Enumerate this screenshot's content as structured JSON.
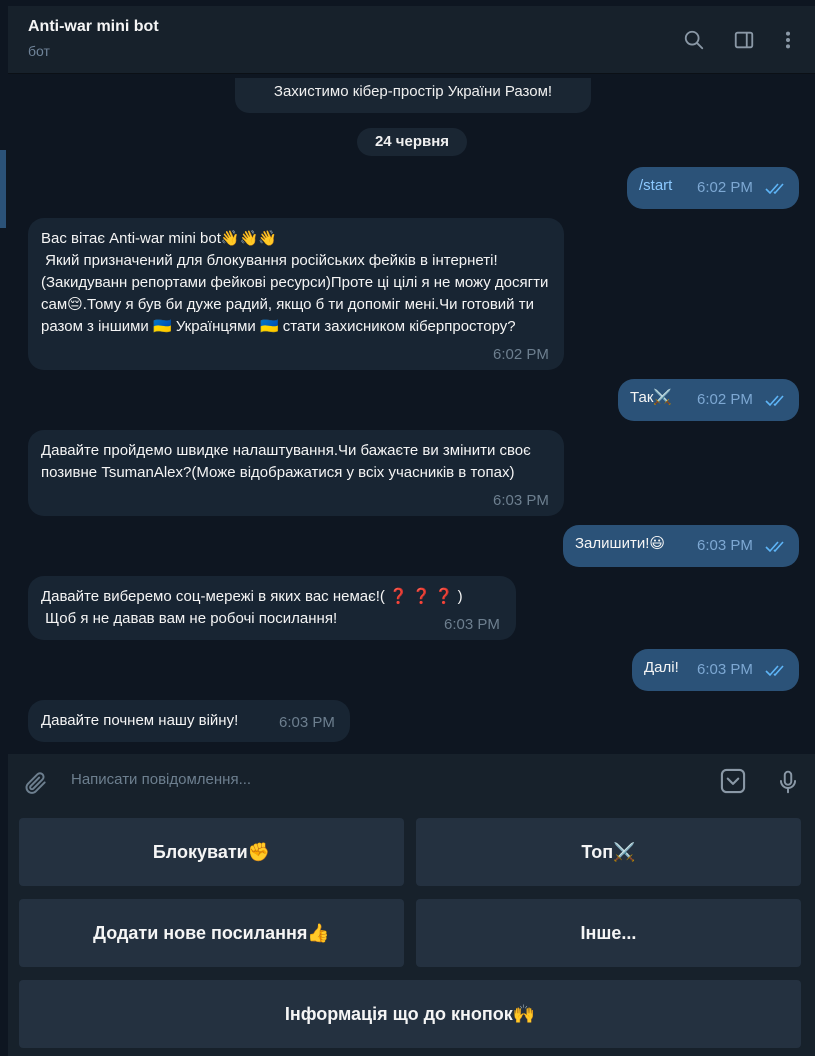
{
  "header": {
    "title": "Anti-war mini bot",
    "subtitle": "бот",
    "icons": [
      "search-icon",
      "sidebar-toggle-icon",
      "more-vertical-icon"
    ]
  },
  "chat": {
    "service_message": "Захистимо кібер-простір України Разом!",
    "date_badge": "24 червня",
    "messages": [
      {
        "direction": "out",
        "text": "/start",
        "time": "6:02 PM",
        "status": "read"
      },
      {
        "direction": "in",
        "text": "Вас вітає Anti-war mini bot👋👋👋\n Який призначений для блокування російських фейків в інтернеті!(Закидуванн репортами фейкові ресурси)Проте ці цілі я не можу досягти сам😔.Тому я був би дуже радий, якщо б ти допоміг мені.Чи готовий ти разом з іншими 🇺🇦 Українцями 🇺🇦 стати захисником кіберпростору?",
        "time": "6:02 PM"
      },
      {
        "direction": "out",
        "text": "Так⚔️",
        "time": "6:02 PM",
        "status": "read"
      },
      {
        "direction": "in",
        "text": "Давайте пройдемо швидке налаштування.Чи бажаєте ви змінити своє позивне TsumanAlex?(Може відображатися у всіх учасників в топах)",
        "time": "6:03 PM"
      },
      {
        "direction": "out",
        "text": "Залишити!😃",
        "time": "6:03 PM",
        "status": "read"
      },
      {
        "direction": "in",
        "text": "Давайте виберемо соц-мережі в яких вас немає!( ❓ ❓ ❓ )\n Щоб я не давав вам не робочі посилання!",
        "time": "6:03 PM"
      },
      {
        "direction": "out",
        "text": "Далі!",
        "time": "6:03 PM",
        "status": "read"
      },
      {
        "direction": "in",
        "text": "Давайте почнем нашу війну!",
        "time": "6:03 PM"
      }
    ]
  },
  "composer": {
    "placeholder": "Написати повідомлення...",
    "icons": [
      "attach-icon",
      "keyboard-toggle-icon",
      "microphone-icon"
    ]
  },
  "keyboard": {
    "buttons": [
      "Блокувати✊",
      "Топ⚔️",
      "Додати нове посилання👍",
      "Інше...",
      "Інформація що до кнопок🙌"
    ]
  },
  "colors": {
    "background": "#0e1621",
    "panel": "#17212b",
    "incoming_bubble": "#182533",
    "outgoing_bubble": "#2b5278",
    "read_check": "#5eb5f7",
    "keyboard_button": "#243140"
  }
}
